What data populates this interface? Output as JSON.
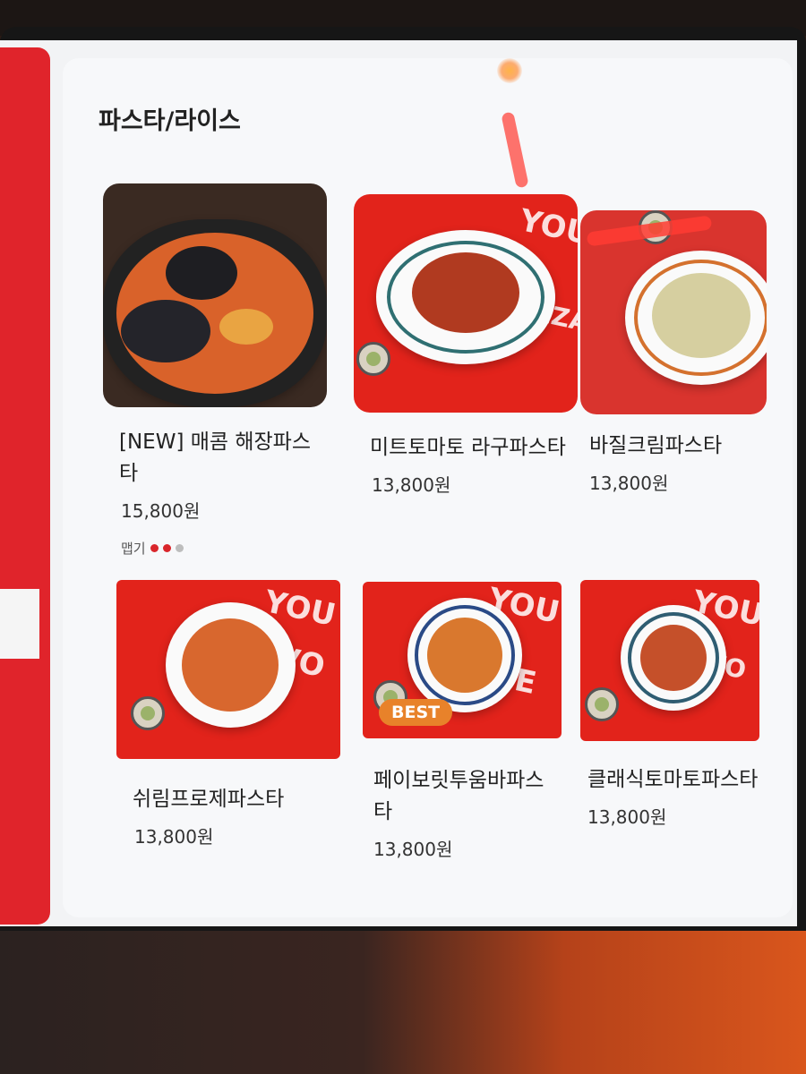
{
  "section": {
    "title": "파스타/라이스"
  },
  "menu": [
    {
      "name": "[NEW] 매콤 해장파스타",
      "price": "15,800원",
      "spicy_label": "맵기",
      "spicy_level": 2,
      "spicy_max": 3,
      "badge": ""
    },
    {
      "name": "미트토마토 라구파스타",
      "price": "13,800원",
      "badge": ""
    },
    {
      "name": "바질크림파스타",
      "price": "13,800원",
      "badge": ""
    },
    {
      "name": "쉬림프로제파스타",
      "price": "13,800원",
      "badge": ""
    },
    {
      "name": "페이보릿투움바파스타",
      "price": "13,800원",
      "badge": "BEST"
    },
    {
      "name": "클래식토마토파스타",
      "price": "13,800원",
      "badge": ""
    }
  ],
  "watermark_text": [
    "YOU",
    "IZZA",
    "YOU",
    "VO",
    "E"
  ],
  "colors": {
    "brand_red": "#e0242b",
    "badge_orange": "#e8822a",
    "spicy_on": "#d9262b",
    "spicy_off": "#bdbdbd"
  }
}
